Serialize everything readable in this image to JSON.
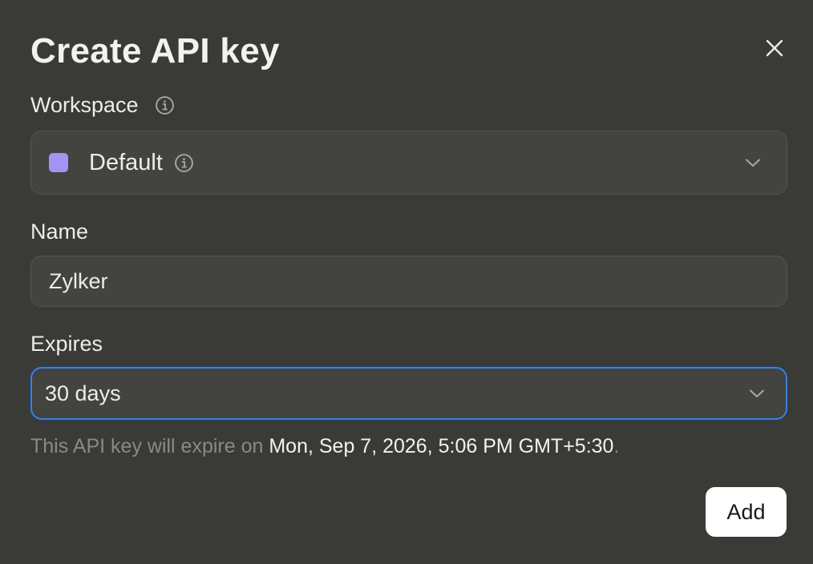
{
  "dialog": {
    "title": "Create API key",
    "close_icon": "close-icon"
  },
  "workspace": {
    "label": "Workspace",
    "info_icon": "info-icon",
    "selected": "Default",
    "swatch_color": "#a394f2",
    "chevron_icon": "chevron-down-icon"
  },
  "name": {
    "label": "Name",
    "value": "Zylker"
  },
  "expires": {
    "label": "Expires",
    "selected": "30 days",
    "chevron_icon": "chevron-down-icon",
    "focus_color": "#3d7fd9"
  },
  "hint": {
    "prefix": "This API key will expire on ",
    "date": "Mon, Sep 7, 2026, 5:06 PM GMT+5:30",
    "suffix": "."
  },
  "actions": {
    "add_label": "Add"
  }
}
